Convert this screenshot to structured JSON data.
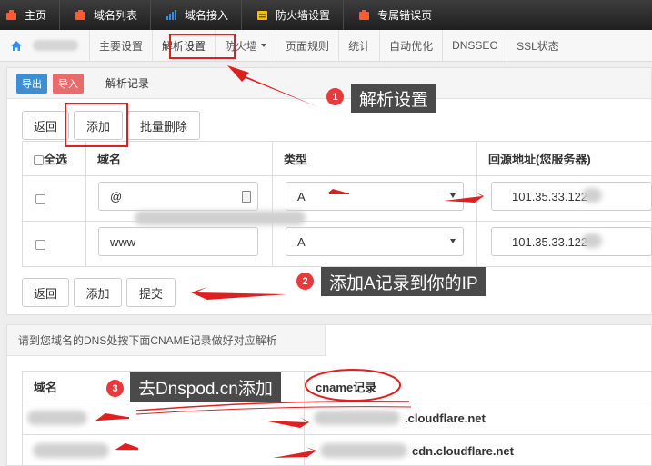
{
  "topnav": {
    "items": [
      {
        "label": "主页",
        "icon": "home-icon",
        "color": "#ff5a36"
      },
      {
        "label": "域名列表",
        "icon": "list-icon",
        "color": "#ff5a36"
      },
      {
        "label": "域名接入",
        "icon": "bar-chart-icon",
        "color": "#3c8dde"
      },
      {
        "label": "防火墙设置",
        "icon": "calendar-icon",
        "color": "#f2c200"
      },
      {
        "label": "专属错误页",
        "icon": "page-icon",
        "color": "#ff5a36"
      }
    ]
  },
  "tabbar": {
    "tabs": [
      "主要设置",
      "解析设置",
      "防火墙",
      "页面规则",
      "统计",
      "自动优化",
      "DNSSEC",
      "SSL状态"
    ],
    "active": "解析设置"
  },
  "records_panel": {
    "export_label": "导出",
    "import_label": "导入",
    "title": "解析记录",
    "back_label": "返回",
    "add_label": "添加",
    "bulk_delete_label": "批量删除",
    "submit_label": "提交",
    "headers": {
      "select_all": "全选",
      "domain": "域名",
      "type": "类型",
      "origin": "回源地址(您服务器)"
    },
    "rows": [
      {
        "domain": "@",
        "type": "A",
        "origin": "101.35.33.122"
      },
      {
        "domain": "www",
        "type": "A",
        "origin": "101.35.33.122"
      }
    ]
  },
  "cname_panel": {
    "notice": "请到您域名的DNS处按下面CNAME记录做好对应解析",
    "headers": {
      "domain": "域名",
      "cname": "cname记录"
    },
    "rows": [
      {
        "cname_suffix": ".cloudflare.net"
      },
      {
        "cname_suffix": "cdn.cloudflare.net"
      }
    ]
  },
  "annotations": {
    "step1": {
      "num": "1",
      "text": "解析设置"
    },
    "step2": {
      "num": "2",
      "text": "添加A记录到你的IP"
    },
    "step3": {
      "num": "3",
      "text": "去Dnspod.cn添加"
    }
  },
  "colors": {
    "export_btn": "#3d8fd1",
    "import_btn": "#e86c6c",
    "annotation": "#e02020"
  }
}
